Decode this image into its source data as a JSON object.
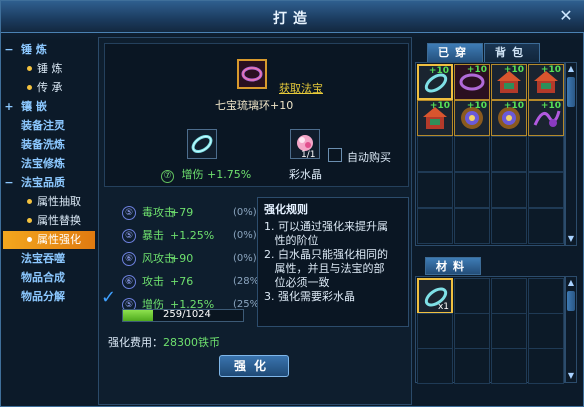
{
  "window": {
    "title": "打造",
    "close_glyph": "✕"
  },
  "sidebar": [
    {
      "kind": "cat",
      "pm": "−",
      "label": "锤  炼"
    },
    {
      "kind": "sub",
      "label": "锤 炼"
    },
    {
      "kind": "sub",
      "label": "传 承"
    },
    {
      "kind": "cat",
      "pm": "+",
      "label": "镶  嵌"
    },
    {
      "kind": "catnp",
      "label": "装备注灵"
    },
    {
      "kind": "catnp",
      "label": "装备洗炼"
    },
    {
      "kind": "catnp",
      "label": "法宝修炼"
    },
    {
      "kind": "cat",
      "pm": "−",
      "label": "法宝品质"
    },
    {
      "kind": "sub",
      "label": "属性抽取"
    },
    {
      "kind": "sub",
      "label": "属性替换"
    },
    {
      "kind": "sub",
      "label": "属性强化",
      "active": true
    },
    {
      "kind": "catnp",
      "label": "法宝吞噬"
    },
    {
      "kind": "catnp",
      "label": "物品合成"
    },
    {
      "kind": "catnp",
      "label": "物品分解"
    }
  ],
  "target": {
    "get_link": "获取法宝",
    "item_name": "七宝琉璃环+10"
  },
  "inputs": {
    "left_stat_num": "⑦",
    "left_stat_text": "增伤 +1.75%",
    "material_count": "1/1",
    "material_name": "彩水晶",
    "auto_buy": "自动购买"
  },
  "stats": [
    {
      "num": "⑤",
      "name": "毒攻击",
      "val": "+79",
      "pct": "(0%)"
    },
    {
      "num": "⑤",
      "name": "暴击",
      "val": "+1.25%",
      "pct": "(0%)"
    },
    {
      "num": "⑥",
      "name": "风攻击",
      "val": "+90",
      "pct": "(0%)"
    },
    {
      "num": "⑥",
      "name": "攻击",
      "val": "+76",
      "pct": "(28%)"
    },
    {
      "num": "⑤",
      "name": "增伤",
      "val": "+1.25%",
      "pct": "(25%)"
    }
  ],
  "progress": {
    "text": "259/1024",
    "value": 259,
    "max": 1024
  },
  "cost": {
    "label": "强化费用：",
    "value": "28300铁币"
  },
  "enhance_button": "强化",
  "rules": {
    "title": "强化规则",
    "lines": [
      "1. 可以通过强化来提升属",
      "   性的阶位",
      "2. 白水晶只能强化相同的",
      "   属性，并且与法宝的部",
      "   位必须一致",
      "3. 强化需要彩水晶"
    ]
  },
  "tabs": {
    "owned": "已穿",
    "bag": "背包"
  },
  "inventory": [
    {
      "plus": "+10",
      "icon": "jade-ring",
      "sel": true
    },
    {
      "plus": "+10",
      "icon": "purple-ring"
    },
    {
      "plus": "+10",
      "icon": "red-pagoda"
    },
    {
      "plus": "+10",
      "icon": "red-pagoda"
    },
    {
      "plus": "+10",
      "icon": "red-pagoda"
    },
    {
      "plus": "+10",
      "icon": "gold-amulet"
    },
    {
      "plus": "+10",
      "icon": "gold-amulet"
    },
    {
      "plus": "+10",
      "icon": "purple-dragon"
    }
  ],
  "materials_title": "材料",
  "materials": [
    {
      "icon": "jade-ring",
      "count": "x1"
    }
  ],
  "colors": {
    "accent": "#f3a71e",
    "green": "#6ee06e",
    "gold": "#e7ca3a"
  }
}
